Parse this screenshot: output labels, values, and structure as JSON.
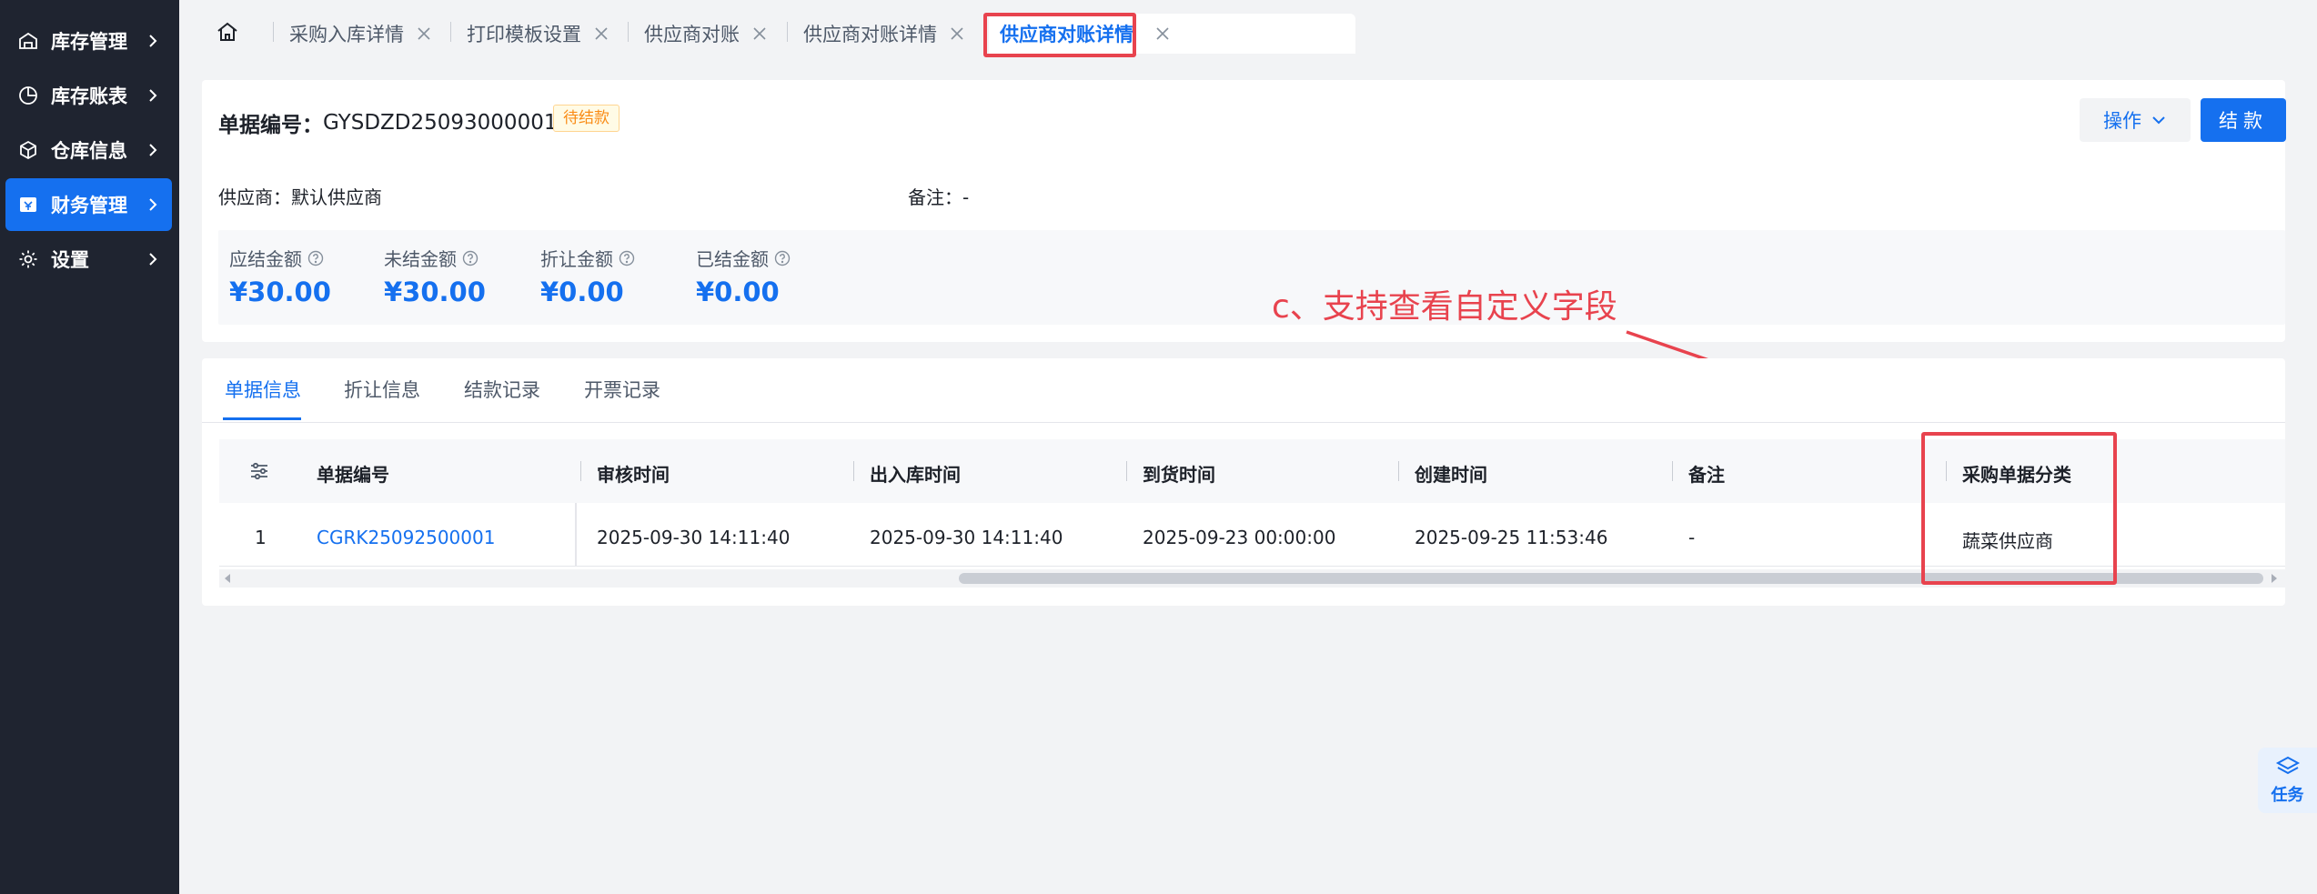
{
  "sidebar": {
    "items": [
      {
        "label": "库存管理",
        "icon": "warehouse-icon"
      },
      {
        "label": "库存账表",
        "icon": "pie-chart-icon"
      },
      {
        "label": "仓库信息",
        "icon": "cube-icon"
      },
      {
        "label": "财务管理",
        "icon": "finance-icon",
        "active": true
      },
      {
        "label": "设置",
        "icon": "gear-icon"
      }
    ]
  },
  "tabs": [
    {
      "label": "采购入库详情"
    },
    {
      "label": "打印模板设置"
    },
    {
      "label": "供应商对账"
    },
    {
      "label": "供应商对账详情"
    },
    {
      "label": "供应商对账详情",
      "active": true
    }
  ],
  "header": {
    "doc_label": "单据编号：",
    "doc_number": "GYSDZD25093000001",
    "status_badge": "待结款",
    "operate_label": "操作",
    "pay_label": "结款"
  },
  "info": {
    "supplier": "供应商：默认供应商",
    "remark": "备注：-"
  },
  "amounts": [
    {
      "label": "应结金额",
      "value": "¥30.00"
    },
    {
      "label": "未结金额",
      "value": "¥30.00"
    },
    {
      "label": "折让金额",
      "value": "¥0.00"
    },
    {
      "label": "已结金额",
      "value": "¥0.00"
    }
  ],
  "subtabs": [
    "单据信息",
    "折让信息",
    "结款记录",
    "开票记录"
  ],
  "table": {
    "columns": [
      "单据编号",
      "审核时间",
      "出入库时间",
      "到货时间",
      "创建时间",
      "备注",
      "采购单据分类"
    ],
    "rows": [
      {
        "index": "1",
        "doc_no": "CGRK25092500001",
        "audit_time": "2025-09-30 14:11:40",
        "io_time": "2025-09-30 14:11:40",
        "arrival_time": "2025-09-23 00:00:00",
        "created_time": "2025-09-25 11:53:46",
        "remark": "-",
        "category": "蔬菜供应商"
      }
    ]
  },
  "annotation": "c、支持查看自定义字段",
  "task_float": {
    "label": "任务",
    "icon": "layers-icon"
  },
  "colors": {
    "accent": "#1570ef",
    "sidebar_bg": "#1f2430",
    "highlight": "#e8434e",
    "badge_text": "#fa8c16"
  }
}
